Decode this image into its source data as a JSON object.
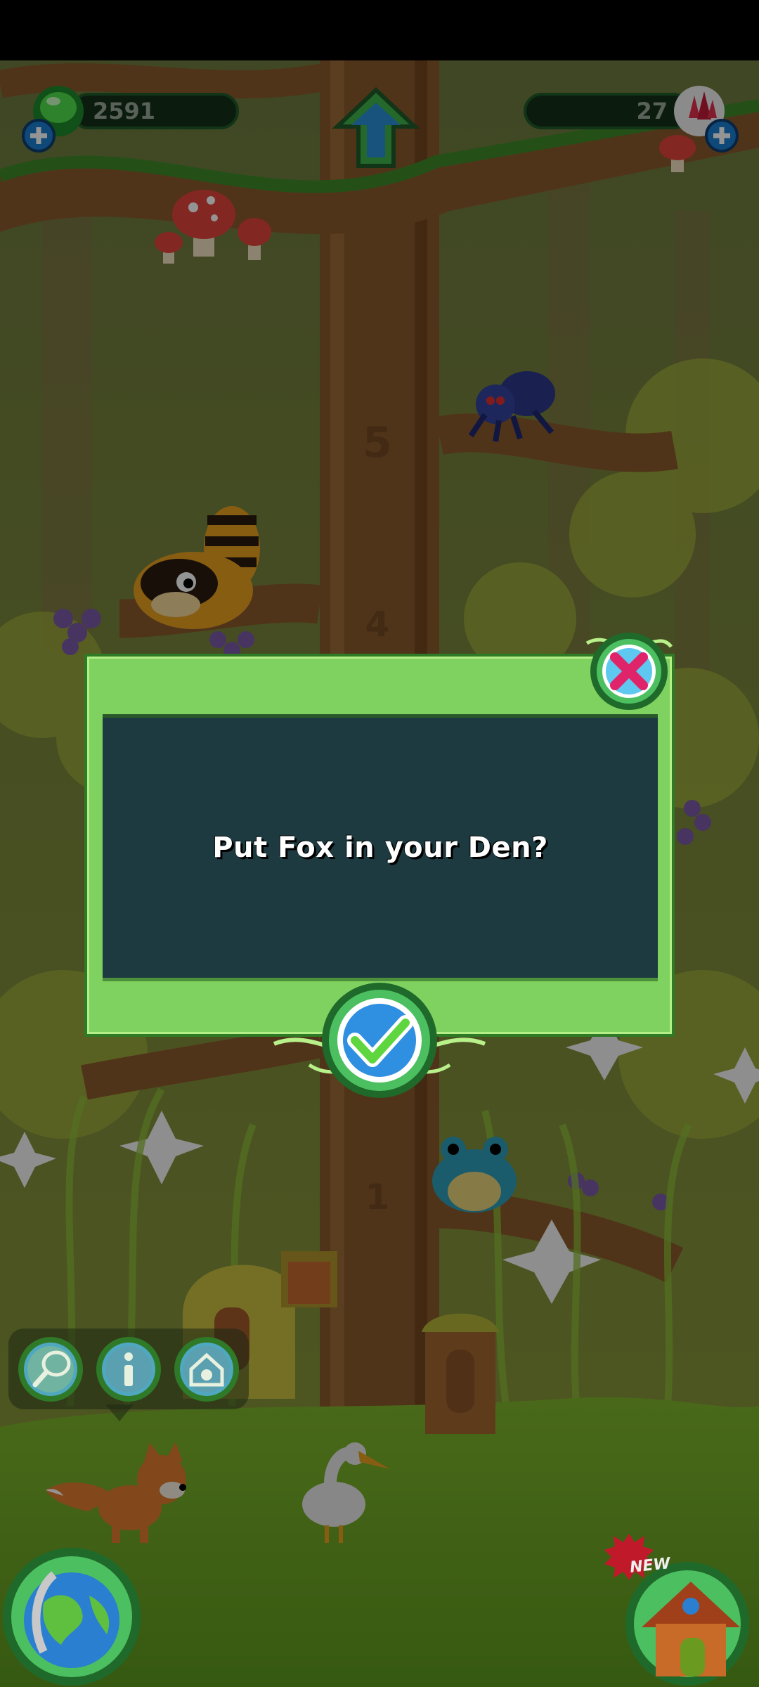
{
  "hud": {
    "gems_count": "2591",
    "crystals_count": "27"
  },
  "tree": {
    "floor_labels": [
      "5",
      "4",
      "1"
    ]
  },
  "dialog": {
    "message": "Put Fox in your Den?"
  },
  "bottom": {
    "new_badge": "NEW"
  },
  "colors": {
    "dialog_frame": "#7fd160",
    "dialog_inner": "#1d3a40",
    "confirm_blue": "#2f8fe0",
    "close_pink": "#e0246a"
  }
}
